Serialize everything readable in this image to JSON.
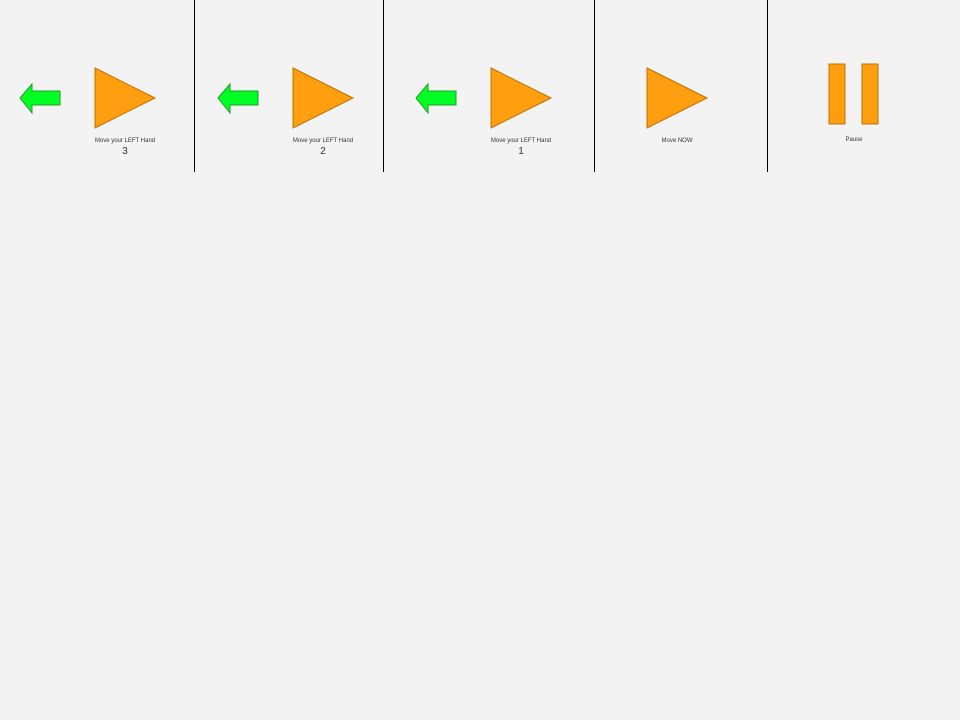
{
  "colors": {
    "background": "#f3f3f3",
    "arrow_fill": "#00ff22",
    "arrow_stroke": "#1f9e2b",
    "shape_fill": "#ff9e0f",
    "shape_stroke": "#c07000",
    "divider": "#000000",
    "text": "#333333"
  },
  "panels": [
    {
      "id": "panel-1",
      "icons": [
        "left-arrow-icon",
        "play-icon"
      ],
      "caption": "Move your LEFT Hand",
      "count": "3"
    },
    {
      "id": "panel-2",
      "icons": [
        "left-arrow-icon",
        "play-icon"
      ],
      "caption": "Move your LEFT Hand",
      "count": "2"
    },
    {
      "id": "panel-3",
      "icons": [
        "left-arrow-icon",
        "play-icon"
      ],
      "caption": "Move your LEFT Hand",
      "count": "1"
    },
    {
      "id": "panel-4",
      "icons": [
        "play-icon"
      ],
      "caption": "Move NOW",
      "count": ""
    },
    {
      "id": "panel-5",
      "icons": [
        "pause-icon"
      ],
      "caption": "Pause",
      "count": ""
    }
  ]
}
